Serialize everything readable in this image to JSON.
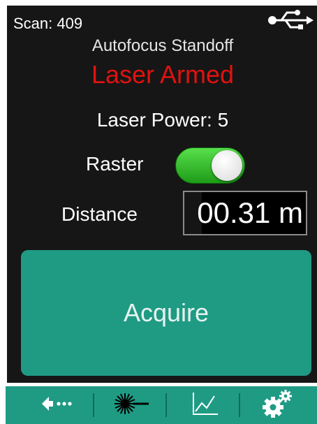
{
  "header": {
    "scan_label": "Scan: 409",
    "usb_icon": "usb-icon"
  },
  "mode": "Autofocus Standoff",
  "status": {
    "text": "Laser Armed",
    "color": "#e0120f"
  },
  "laser_power": "Laser Power: 5",
  "raster": {
    "label": "Raster",
    "enabled": true
  },
  "distance": {
    "label": "Distance",
    "value": "00.31 m"
  },
  "acquire_label": "Acquire",
  "nav": {
    "items": [
      {
        "icon": "back-icon"
      },
      {
        "icon": "laser-icon"
      },
      {
        "icon": "chart-icon"
      },
      {
        "icon": "settings-icon"
      }
    ]
  },
  "colors": {
    "accent": "#1f9b84",
    "background": "#161616",
    "toggle_on": "#2fb82a"
  }
}
